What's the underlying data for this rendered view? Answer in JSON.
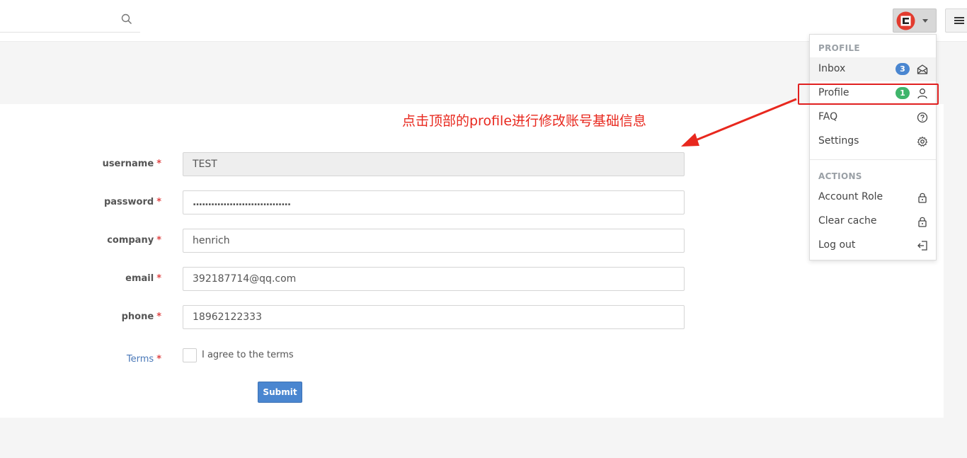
{
  "search": {
    "placeholder": ""
  },
  "annotation": {
    "text": "点击顶部的profile进行修改账号基础信息"
  },
  "form": {
    "fields": [
      {
        "label": "username",
        "required_mark": "*",
        "value": "TEST"
      },
      {
        "label": "password",
        "required_mark": "*",
        "value": "................................"
      },
      {
        "label": "company",
        "required_mark": "*",
        "value": "henrich"
      },
      {
        "label": "email",
        "required_mark": "*",
        "value": "392187714@qq.com"
      },
      {
        "label": "phone",
        "required_mark": "*",
        "value": "18962122333"
      }
    ],
    "terms": {
      "label": "Terms",
      "required_mark": "*",
      "text": "I agree to the terms"
    },
    "submit_label": "Submit"
  },
  "dropdown": {
    "profile_header": "PROFILE",
    "actions_header": "ACTIONS",
    "items": [
      {
        "label": "Inbox",
        "badge": "3",
        "icon": "envelope-open-icon"
      },
      {
        "label": "Profile",
        "badge": "1",
        "icon": "user-icon"
      },
      {
        "label": "FAQ",
        "icon": "question-circle-icon"
      },
      {
        "label": "Settings",
        "icon": "gear-icon"
      }
    ],
    "actions": [
      {
        "label": "Account Role",
        "icon": "lock-icon"
      },
      {
        "label": "Clear cache",
        "icon": "lock-icon"
      },
      {
        "label": "Log out",
        "icon": "logout-icon"
      }
    ]
  },
  "colors": {
    "inbox_badge": "#4a86d0",
    "profile_badge": "#3fb56b",
    "annotation": "#e8281e",
    "submit": "#4a86d0"
  }
}
